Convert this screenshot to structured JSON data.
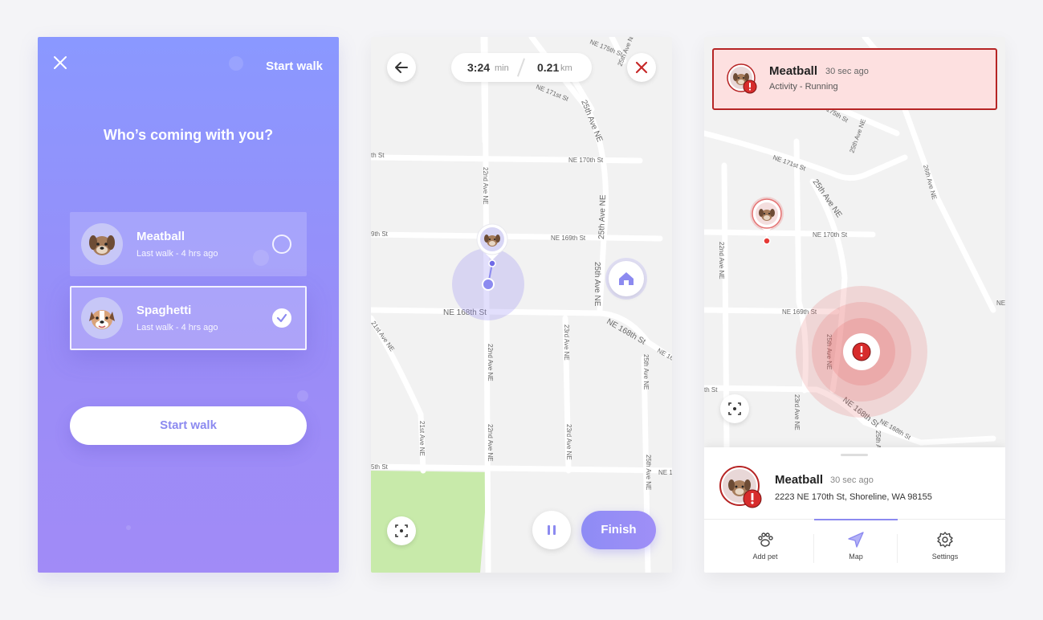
{
  "screen_walk_setup": {
    "header_action": "Start walk",
    "title": "Who’s coming with you?",
    "pets": [
      {
        "name": "Meatball",
        "subtitle": "Last walk - 4 hrs ago",
        "selected": false
      },
      {
        "name": "Spaghetti",
        "subtitle": "Last walk - 4 hrs ago",
        "selected": true
      }
    ],
    "primary_button": "Start walk",
    "accent_color": "#8c8af0"
  },
  "screen_walk_tracking": {
    "duration_value": "3:24",
    "duration_unit": "min",
    "distance_value": "0.21",
    "distance_unit": "km",
    "finish_button": "Finish",
    "streets": {
      "ne175": "NE 175th St",
      "ne171": "NE 171st St",
      "ne170": "NE 170th St",
      "ne169": "NE 169th St",
      "ne168": "NE 168th St",
      "ave22": "22nd Ave NE",
      "ave23": "23rd Ave NE",
      "ave25": "25th Ave NE",
      "ave21": "21st Ave NE",
      "partial_th": "th St",
      "partial_9th": "9th St",
      "partial_5th": "5th St",
      "partial_ne16": "NE 16",
      "partial_ne1": "NE 1"
    }
  },
  "screen_alert": {
    "alert": {
      "name": "Meatball",
      "time": "30 sec ago",
      "activity": "Activity - Running"
    },
    "sheet": {
      "name": "Meatball",
      "time": "30 sec ago",
      "address": "2223 NE 170th St, Shoreline, WA 98155"
    },
    "nav": [
      {
        "label": "Add pet",
        "icon": "paw-icon"
      },
      {
        "label": "Map",
        "icon": "navigation-arrow-icon"
      },
      {
        "label": "Settings",
        "icon": "gear-icon"
      }
    ],
    "streets": {
      "ne175": "NE 175th St",
      "ne171": "NE 171st St",
      "ne170": "NE 170th St",
      "ne169": "NE 169th St",
      "ne168": "NE 168th St",
      "ave25": "25th Ave NE",
      "ave26": "26th Ave NE",
      "ave23": "23rd Ave NE",
      "ave22": "22nd Ave NE",
      "partial_th": "th St",
      "partial_ne": "NE"
    },
    "alert_color": "#d72c2c"
  }
}
